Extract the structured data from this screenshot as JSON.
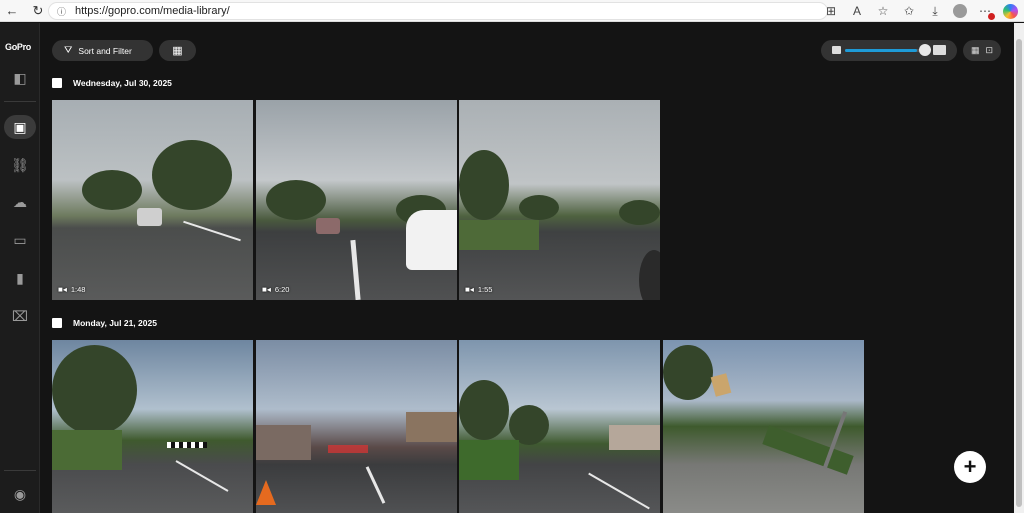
{
  "browser": {
    "url": "https://gopro.com/media-library/"
  },
  "sidebar": {
    "logo": "GoPro",
    "items": [
      {
        "name": "panel-toggle-icon",
        "glyph": "◧"
      },
      {
        "name": "media-library-icon",
        "glyph": "▣",
        "active": true
      },
      {
        "name": "links-icon",
        "glyph": "⛓"
      },
      {
        "name": "upload-icon",
        "glyph": "☁"
      },
      {
        "name": "live-icon",
        "glyph": "▭"
      },
      {
        "name": "albums-icon",
        "glyph": "▮"
      },
      {
        "name": "trash-icon",
        "glyph": "🗑"
      }
    ],
    "account_glyph": "◉"
  },
  "toolbar": {
    "sort_label": "Sort and Filter",
    "zoom_level": 0.9
  },
  "groups": [
    {
      "date": "Wednesday, Jul 30, 2025",
      "items": [
        {
          "duration": "1:48"
        },
        {
          "duration": "6:20"
        },
        {
          "duration": "1:55"
        }
      ]
    },
    {
      "date": "Monday, Jul 21, 2025",
      "items": [
        {
          "duration": ""
        },
        {
          "duration": ""
        },
        {
          "duration": ""
        },
        {
          "duration": ""
        }
      ]
    }
  ],
  "fab_label": "+"
}
